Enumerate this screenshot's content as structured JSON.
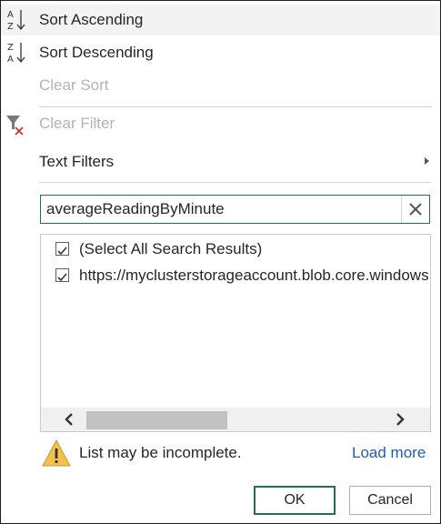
{
  "menu": {
    "sort_ascending": "Sort Ascending",
    "sort_descending": "Sort Descending",
    "clear_sort": "Clear Sort",
    "clear_filter": "Clear Filter",
    "text_filters": "Text Filters"
  },
  "search": {
    "value": "averageReadingByMinute"
  },
  "list": {
    "items": [
      {
        "label": "(Select All Search Results)",
        "checked": true
      },
      {
        "label": "https://myclusterstorageaccount.blob.core.windows",
        "checked": true
      }
    ]
  },
  "footer": {
    "warning_text": "List may be incomplete.",
    "load_more": "Load more",
    "ok_label": "OK",
    "cancel_label": "Cancel"
  },
  "colors": {
    "accent": "#217346",
    "link": "#1e5fa8",
    "clear_filter_x": "#d13438",
    "warning": "#f2c14e"
  }
}
